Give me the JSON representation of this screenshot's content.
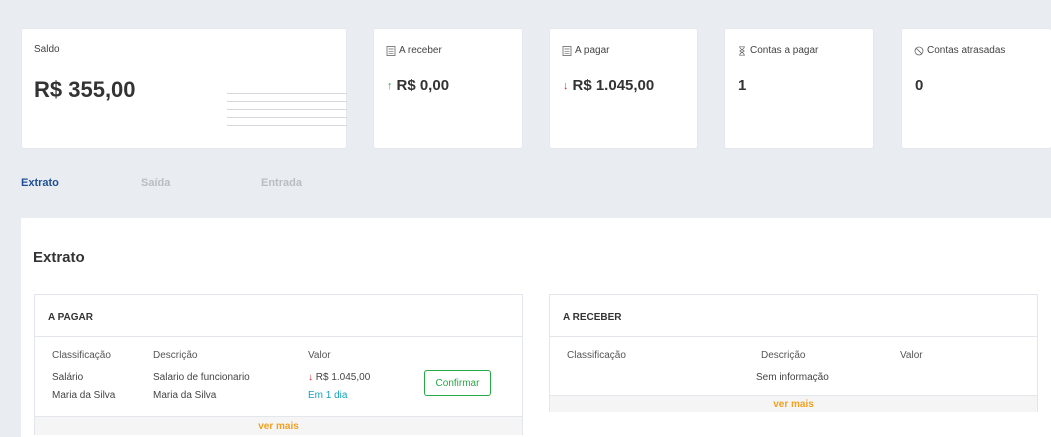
{
  "cards": {
    "saldo": {
      "label": "Saldo",
      "value": "R$ 355,00"
    },
    "receber": {
      "label": "A receber",
      "value": "R$ 0,00",
      "icon": "calculator-icon"
    },
    "pagar": {
      "label": "A pagar",
      "value": "R$ 1.045,00",
      "icon": "calculator-icon"
    },
    "contas": {
      "label": "Contas a pagar",
      "value": "1",
      "icon": "hourglass-icon"
    },
    "atrasadas": {
      "label": "Contas atrasadas",
      "value": "0",
      "icon": "ban-icon"
    }
  },
  "tabs": [
    {
      "label": "Extrato",
      "active": true
    },
    {
      "label": "Saída",
      "active": false
    },
    {
      "label": "Entrada",
      "active": false
    }
  ],
  "panel": {
    "title": "Extrato",
    "pagar": {
      "header": "A PAGAR",
      "columns": [
        "Classificação",
        "Descrição",
        "Valor"
      ],
      "rows": [
        {
          "classificacao": "Salário",
          "classificacao2": "Maria da Silva",
          "descricao": "Salario de funcionario",
          "descricao2": "Maria da Silva",
          "valor": "R$ 1.045,00",
          "prazo": "Em 1 dia",
          "action": "Confirmar"
        }
      ],
      "more": "ver mais"
    },
    "receber": {
      "header": "A RECEBER",
      "columns": [
        "Classificação",
        "Descrição",
        "Valor"
      ],
      "empty": "Sem informação",
      "more": "ver mais"
    }
  },
  "colors": {
    "accent": "#1f4e96",
    "success": "#28a745",
    "danger": "#e02424",
    "info": "#17a2b8",
    "warning": "#f0a020"
  }
}
